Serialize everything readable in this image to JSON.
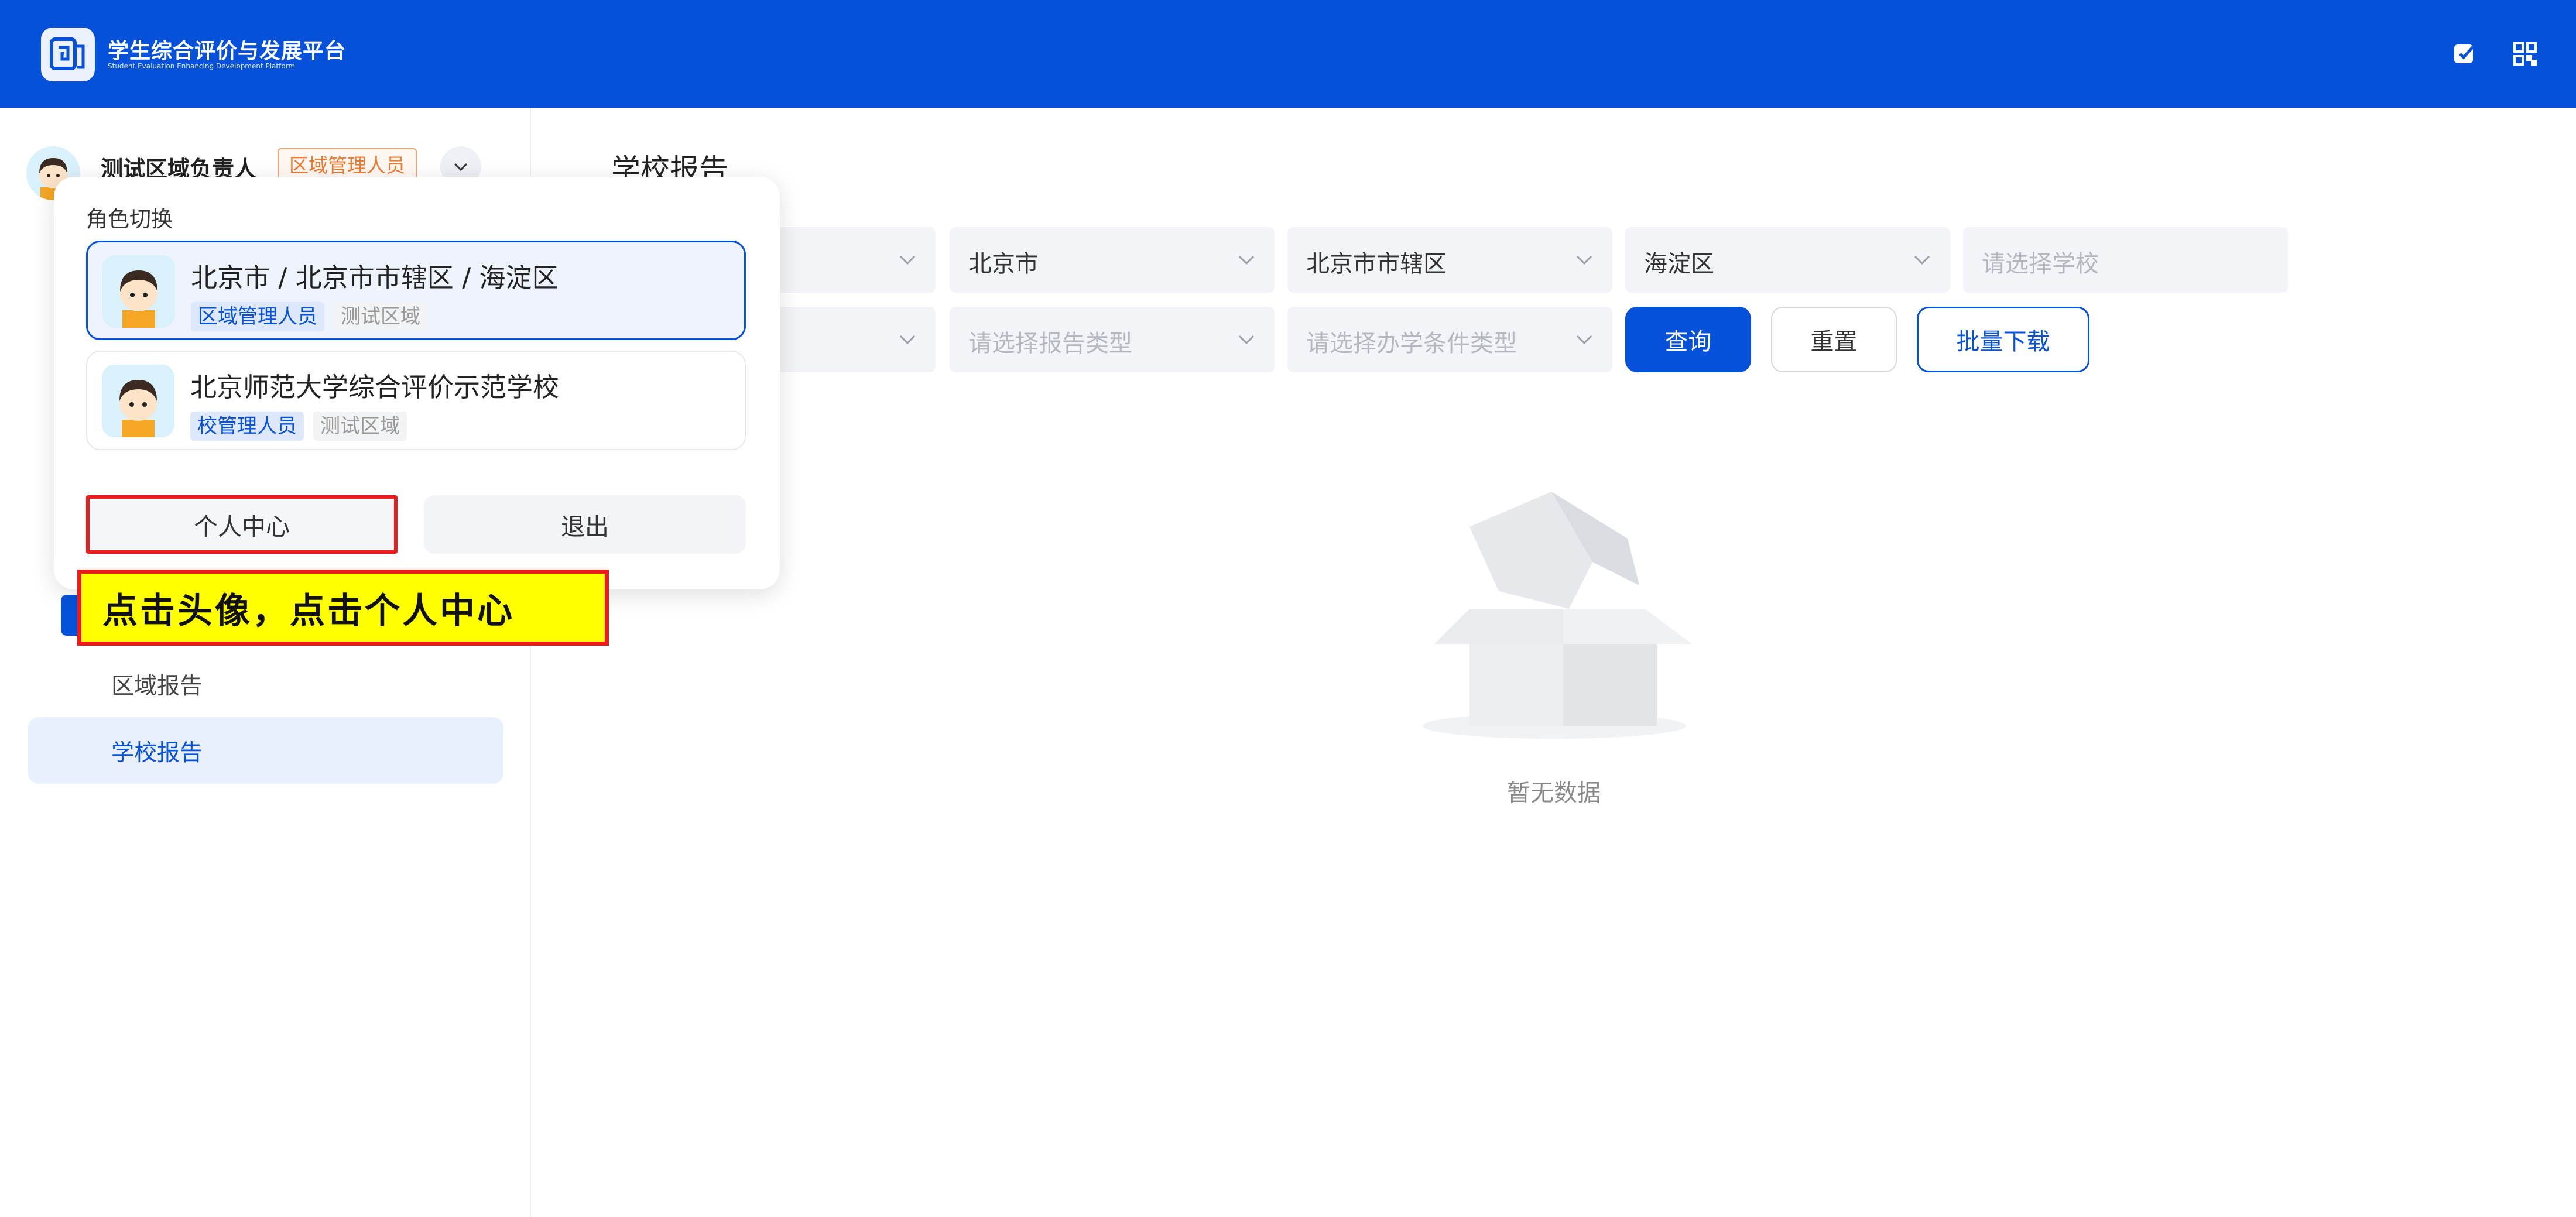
{
  "header": {
    "title": "学生综合评价与发展平台",
    "subtitle": "Student Evaluation Enhancing Development Platform",
    "icons": [
      "logo-icon",
      "edit-icon",
      "qr-code-icon"
    ],
    "brand_color": "#0651d9"
  },
  "user": {
    "name": "测试区域负责人",
    "role_badge": "区域管理人员",
    "badge_color": "#ee7b2f"
  },
  "sidebar": {
    "items": [
      {
        "label": "区域报告",
        "active": false
      },
      {
        "label": "学校报告",
        "active": true
      }
    ]
  },
  "page": {
    "title": "学校报告"
  },
  "filters": {
    "row1": [
      {
        "value": "北京市",
        "placeholder": ""
      },
      {
        "value": "北京市市辖区",
        "placeholder": ""
      },
      {
        "value": "海淀区",
        "placeholder": ""
      },
      {
        "value": "",
        "placeholder": "请选择学校"
      }
    ],
    "row2": [
      {
        "value": "",
        "placeholder": "请选择报告类型"
      },
      {
        "value": "",
        "placeholder": "请选择办学条件类型"
      }
    ],
    "buttons": {
      "query": "查询",
      "reset": "重置",
      "batch_download": "批量下载"
    }
  },
  "empty_state": {
    "text": "暂无数据"
  },
  "role_popover": {
    "title": "角色切换",
    "roles": [
      {
        "name": "北京市 / 北京市市辖区 / 海淀区",
        "role": "区域管理人员",
        "tag": "测试区域",
        "selected": true
      },
      {
        "name": "北京师范大学综合评价示范学校",
        "role": "校管理人员",
        "tag": "测试区域",
        "selected": false
      }
    ],
    "personal_center": "个人中心",
    "logout": "退出"
  },
  "annotation": {
    "text": "点击头像，点击个人中心"
  }
}
